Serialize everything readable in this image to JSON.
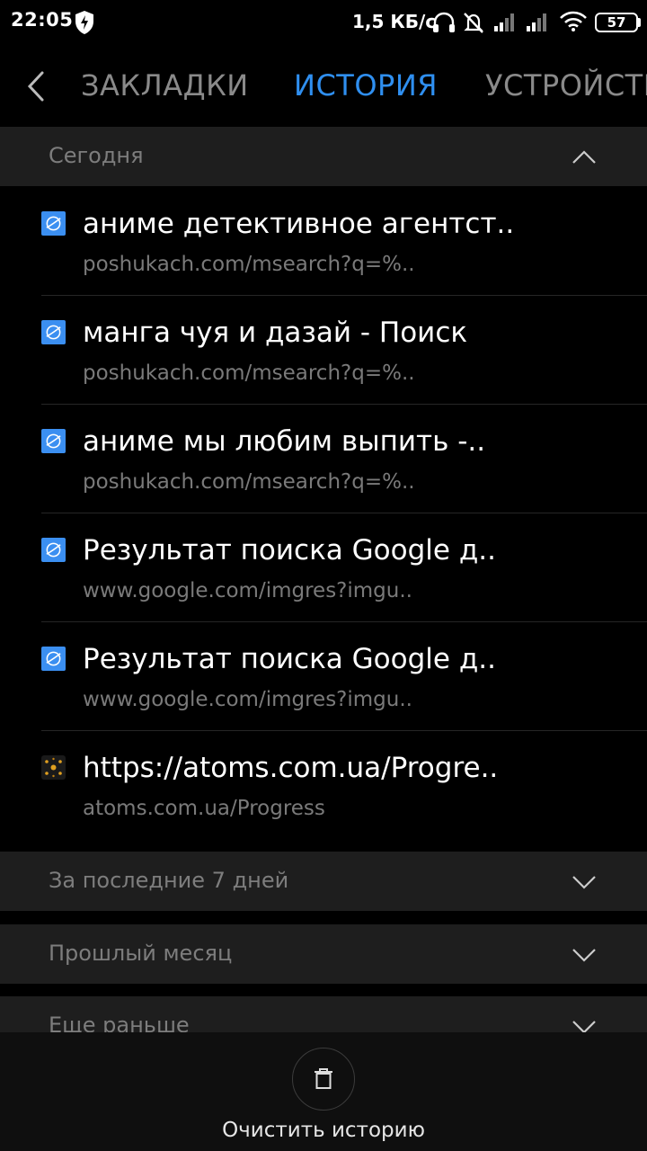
{
  "status_bar": {
    "time": "22:05",
    "speed": "1,5 КБ/с",
    "battery": "57",
    "icons": [
      "shield-icon",
      "headphones-icon",
      "alarm-off-icon",
      "signal-icon",
      "signal-icon",
      "wifi-icon",
      "battery-icon"
    ]
  },
  "nav": {
    "back_icon": "chevron-left-icon",
    "tabs": [
      "ЗАКЛАДКИ",
      "ИСТОРИЯ",
      "УСТРОЙСТВА"
    ],
    "active_tab": "ИСТОРИЯ",
    "active_color": "#2f8ff0"
  },
  "sections": {
    "today": "Сегодня",
    "last7": "За последние 7 дней",
    "last_month": "Прошлый месяц",
    "earlier": "Еще раньше"
  },
  "history": [
    {
      "title": "аниме детективное агентст..",
      "url": "poshukach.com/msearch?q=%..",
      "icon": "globe-icon"
    },
    {
      "title": "манга чуя и дазай - Поиск",
      "url": "poshukach.com/msearch?q=%..",
      "icon": "globe-icon"
    },
    {
      "title": "аниме мы любим выпить -..",
      "url": "poshukach.com/msearch?q=%..",
      "icon": "globe-icon"
    },
    {
      "title": "Результат поиска Google д..",
      "url": "www.google.com/imgres?imgu..",
      "icon": "globe-icon"
    },
    {
      "title": "Результат поиска Google д..",
      "url": "www.google.com/imgres?imgu..",
      "icon": "globe-icon"
    },
    {
      "title": "https://atoms.com.ua/Progre..",
      "url": "atoms.com.ua/Progress",
      "icon": "atoms-favicon-icon"
    }
  ],
  "bottom": {
    "clear_label": "Очистить историю",
    "icon": "trash-icon"
  },
  "colors": {
    "accent": "#2f8ff0",
    "favicon_blue": "#3b8ff1",
    "section_bg": "#1e1e1e"
  }
}
